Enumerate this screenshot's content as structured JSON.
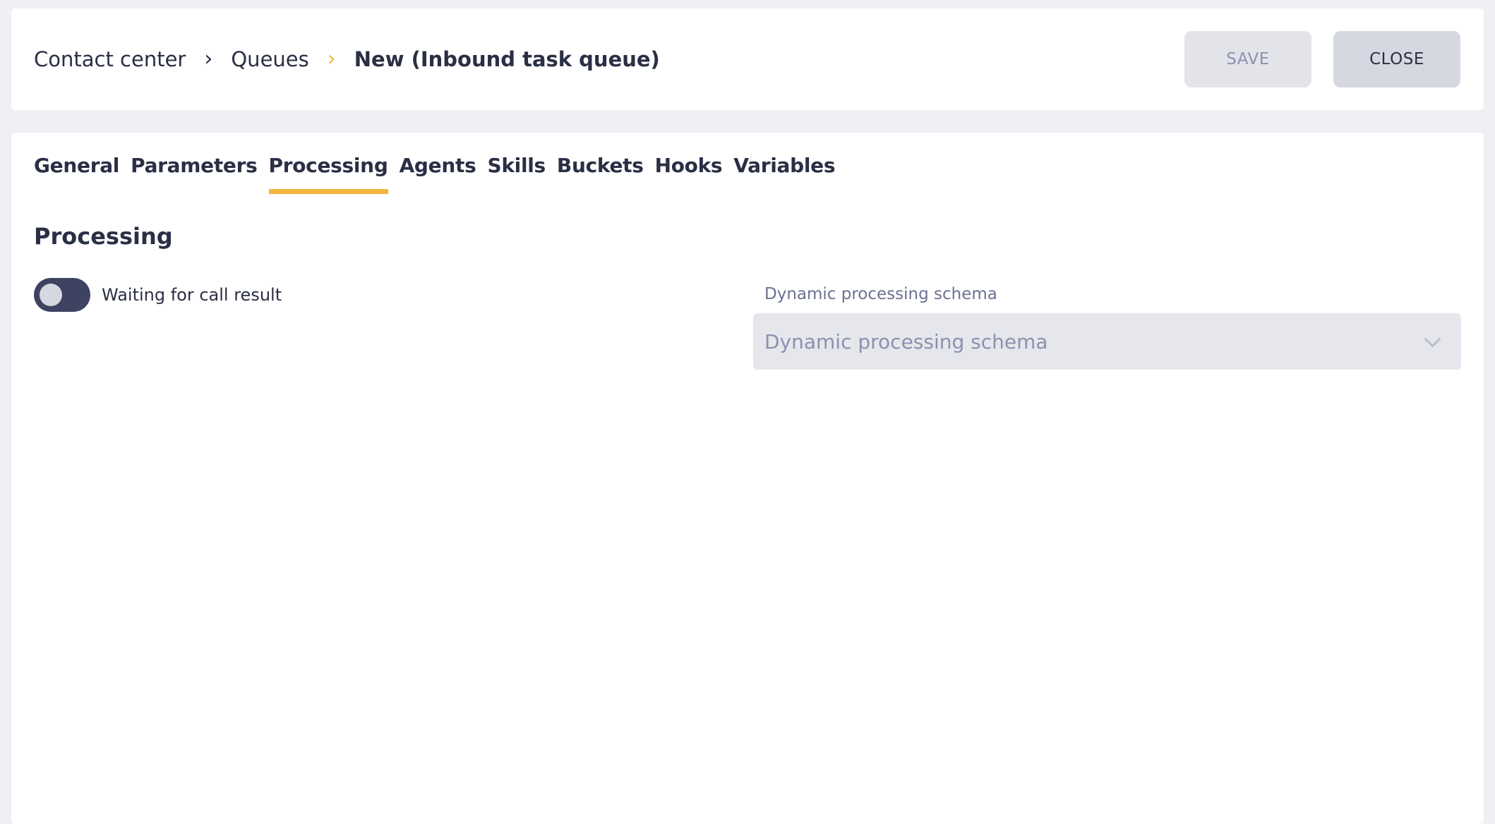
{
  "header": {
    "breadcrumb": [
      {
        "label": "Contact center"
      },
      {
        "label": "Queues"
      },
      {
        "label": "New (Inbound task queue)"
      }
    ],
    "save_label": "SAVE",
    "close_label": "CLOSE"
  },
  "tabs": [
    {
      "label": "General"
    },
    {
      "label": "Parameters"
    },
    {
      "label": "Processing",
      "active": true
    },
    {
      "label": "Agents"
    },
    {
      "label": "Skills"
    },
    {
      "label": "Buckets"
    },
    {
      "label": "Hooks"
    },
    {
      "label": "Variables"
    }
  ],
  "processing": {
    "title": "Processing",
    "toggle": {
      "label": "Waiting for call result",
      "on": false
    },
    "schema_field": {
      "label": "Dynamic processing schema",
      "placeholder": "Dynamic processing schema"
    }
  },
  "colors": {
    "accent": "#f0b53c",
    "text": "#2a2f45",
    "background": "#eff0f3"
  }
}
